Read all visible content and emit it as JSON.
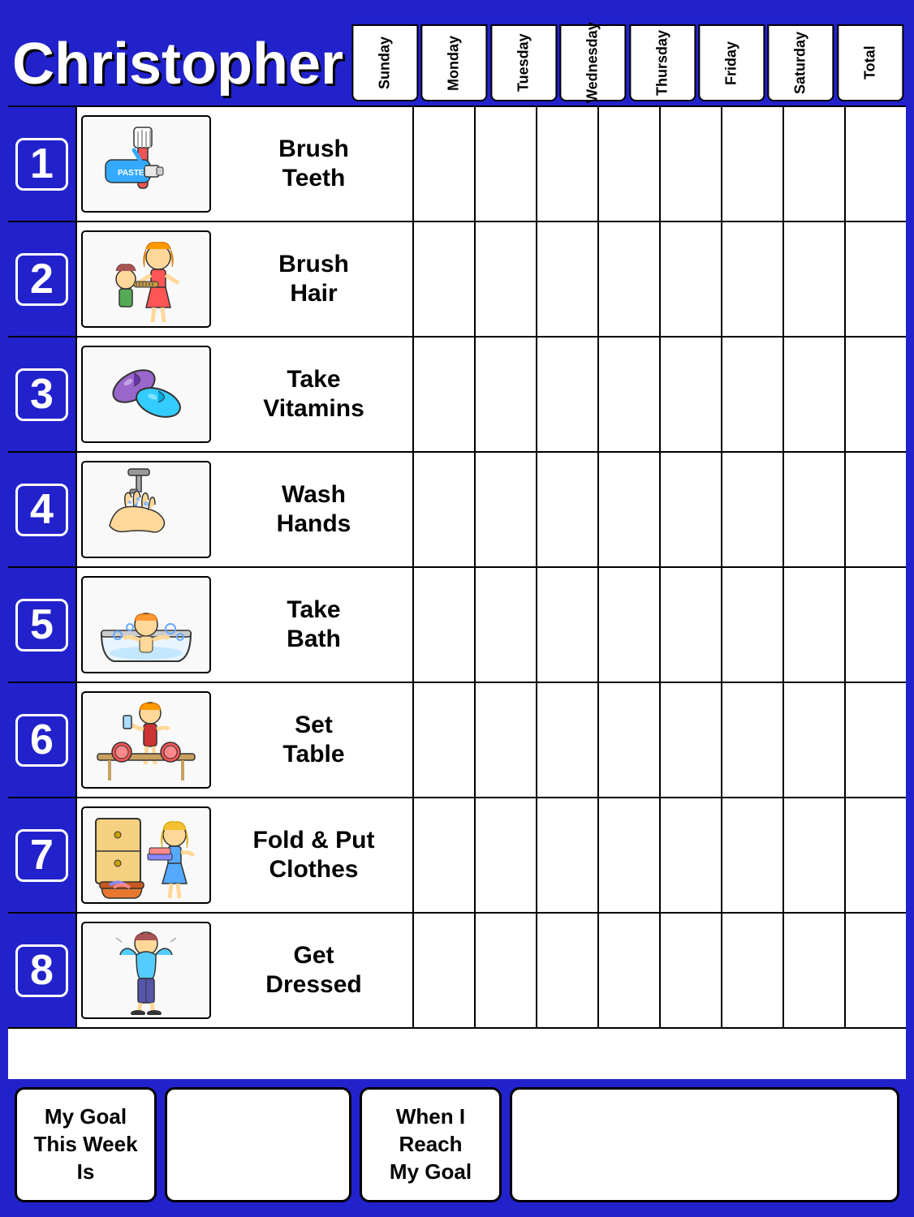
{
  "header": {
    "name": "Christopher",
    "days": [
      "Sunday",
      "Monday",
      "Tuesday",
      "Wednesday",
      "Thursday",
      "Friday",
      "Saturday",
      "Total"
    ]
  },
  "chores": [
    {
      "number": "1",
      "label": "Brush\nTeeth",
      "icon": "brush-teeth"
    },
    {
      "number": "2",
      "label": "Brush\nHair",
      "icon": "brush-hair"
    },
    {
      "number": "3",
      "label": "Take\nVitamins",
      "icon": "take-vitamins"
    },
    {
      "number": "4",
      "label": "Wash\nHands",
      "icon": "wash-hands"
    },
    {
      "number": "5",
      "label": "Take\nBath",
      "icon": "take-bath"
    },
    {
      "number": "6",
      "label": "Set\nTable",
      "icon": "set-table"
    },
    {
      "number": "7",
      "label": "Fold & Put\nClothes",
      "icon": "fold-clothes"
    },
    {
      "number": "8",
      "label": "Get\nDressed",
      "icon": "get-dressed"
    }
  ],
  "footer": {
    "goal_label": "My Goal\nThis Week\nIs",
    "reach_label": "When I\nReach\nMy Goal"
  },
  "colors": {
    "blue": "#2222cc",
    "white": "#ffffff",
    "black": "#000000"
  }
}
